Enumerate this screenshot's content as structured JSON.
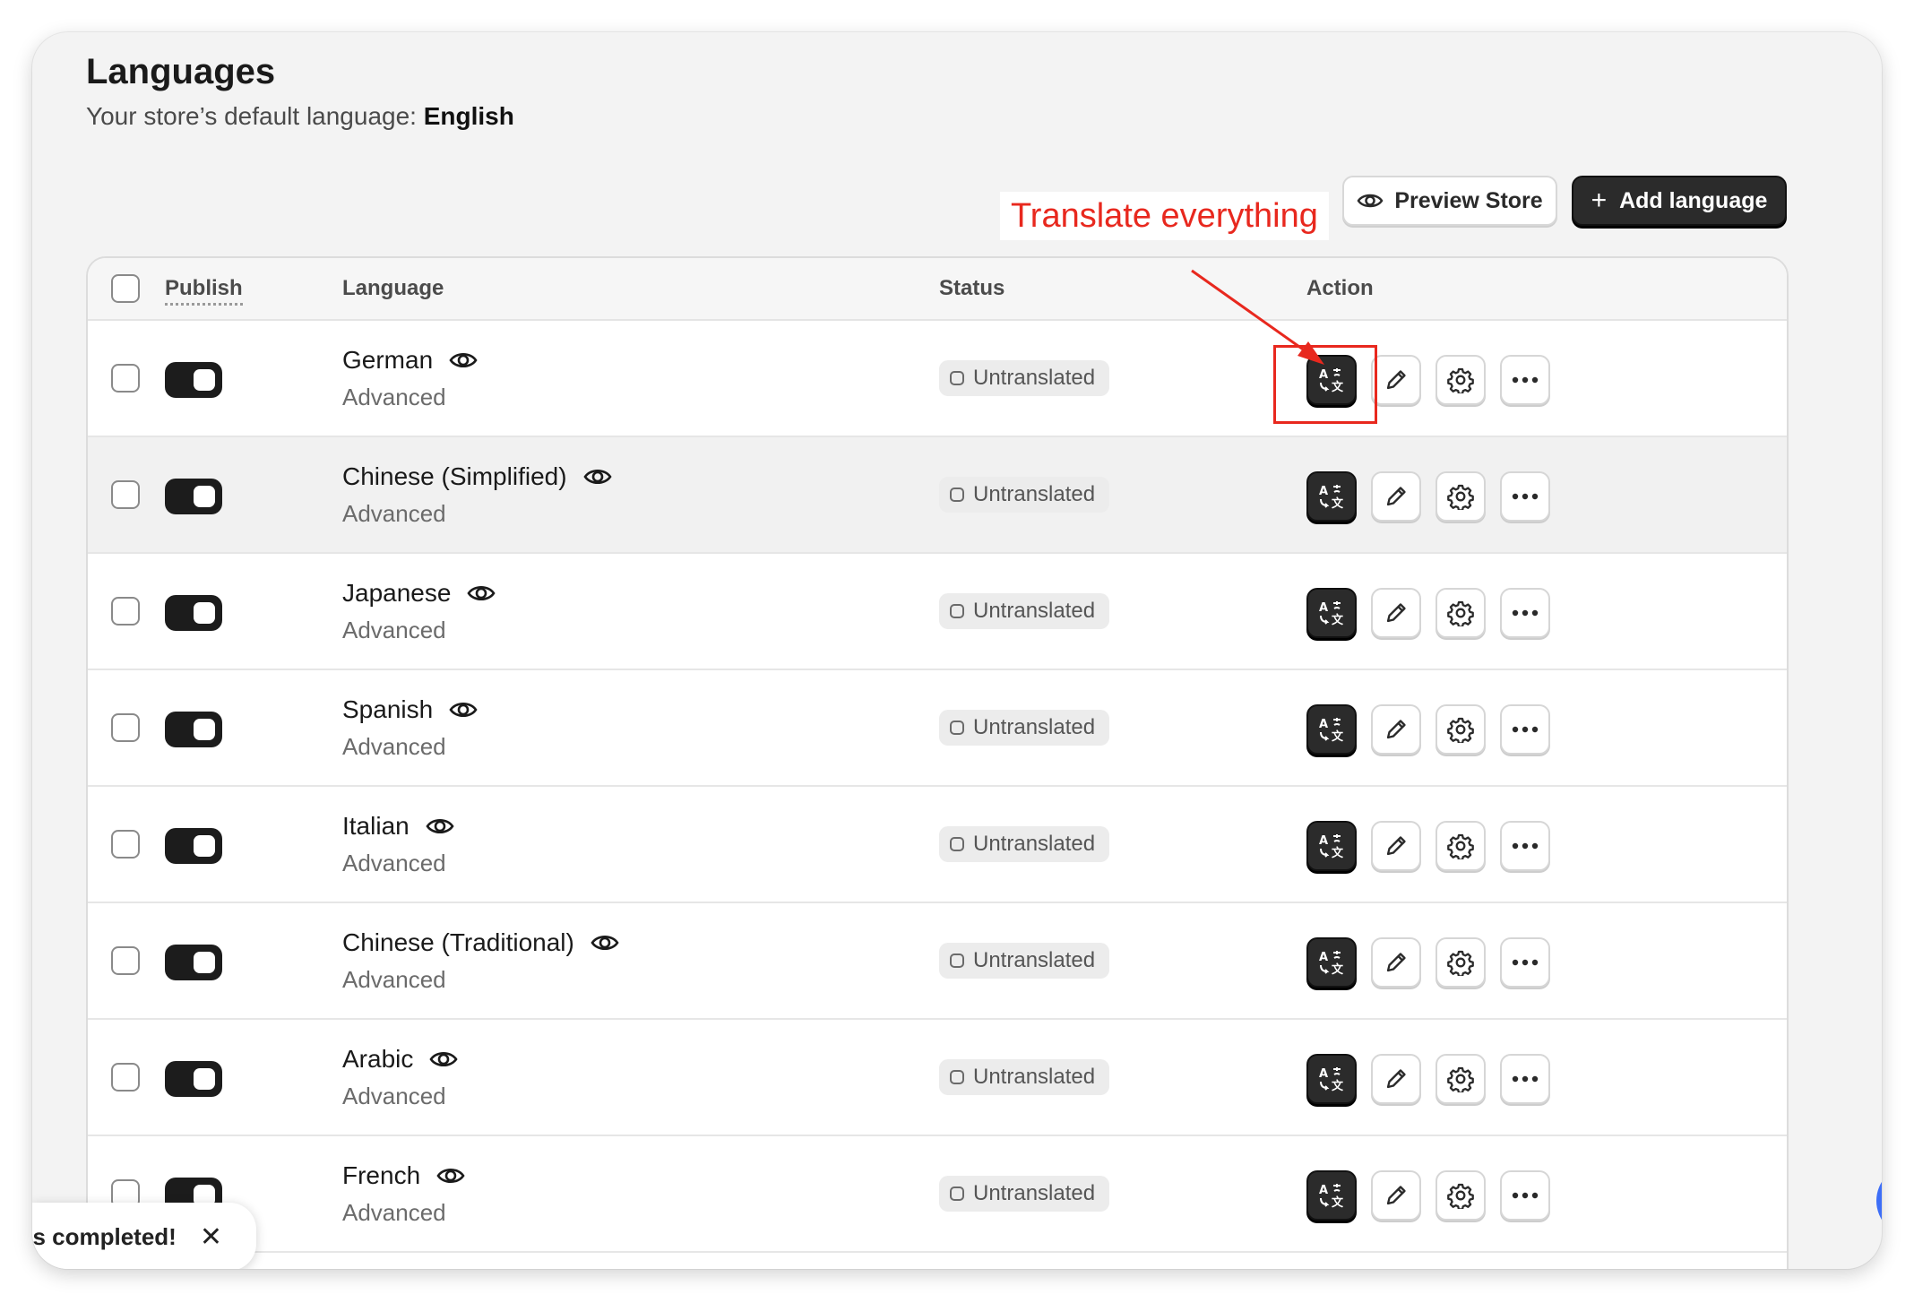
{
  "page": {
    "title": "Languages",
    "subtitle_prefix": "Your store’s default language:",
    "default_language": "English"
  },
  "annotation": {
    "label": "Translate everything",
    "color": "#e8281e"
  },
  "toolbar": {
    "preview_label": "Preview Store",
    "add_label": "Add language",
    "add_icon": "+"
  },
  "table": {
    "columns": {
      "publish": "Publish",
      "language": "Language",
      "status": "Status",
      "action": "Action"
    },
    "rows": [
      {
        "name": "German",
        "sub": "Advanced",
        "status": "Untranslated",
        "published": true
      },
      {
        "name": "Chinese (Simplified)",
        "sub": "Advanced",
        "status": "Untranslated",
        "published": true
      },
      {
        "name": "Japanese",
        "sub": "Advanced",
        "status": "Untranslated",
        "published": true
      },
      {
        "name": "Spanish",
        "sub": "Advanced",
        "status": "Untranslated",
        "published": true
      },
      {
        "name": "Italian",
        "sub": "Advanced",
        "status": "Untranslated",
        "published": true
      },
      {
        "name": "Chinese (Traditional)",
        "sub": "Advanced",
        "status": "Untranslated",
        "published": true
      },
      {
        "name": "Arabic",
        "sub": "Advanced",
        "status": "Untranslated",
        "published": true
      },
      {
        "name": "French",
        "sub": "Advanced",
        "status": "Untranslated",
        "published": true
      }
    ]
  },
  "toast": {
    "text": "ks completed!",
    "close": "✕"
  },
  "icons": {
    "eye": "eye-icon",
    "translate": "translate-icon",
    "edit": "pencil-icon",
    "settings": "gear-icon",
    "more": "more-horizontal-icon"
  },
  "colors": {
    "primary_dark": "#2b2b2b",
    "accent_blue": "#3d6ef7",
    "highlight_red": "#e8281e"
  }
}
